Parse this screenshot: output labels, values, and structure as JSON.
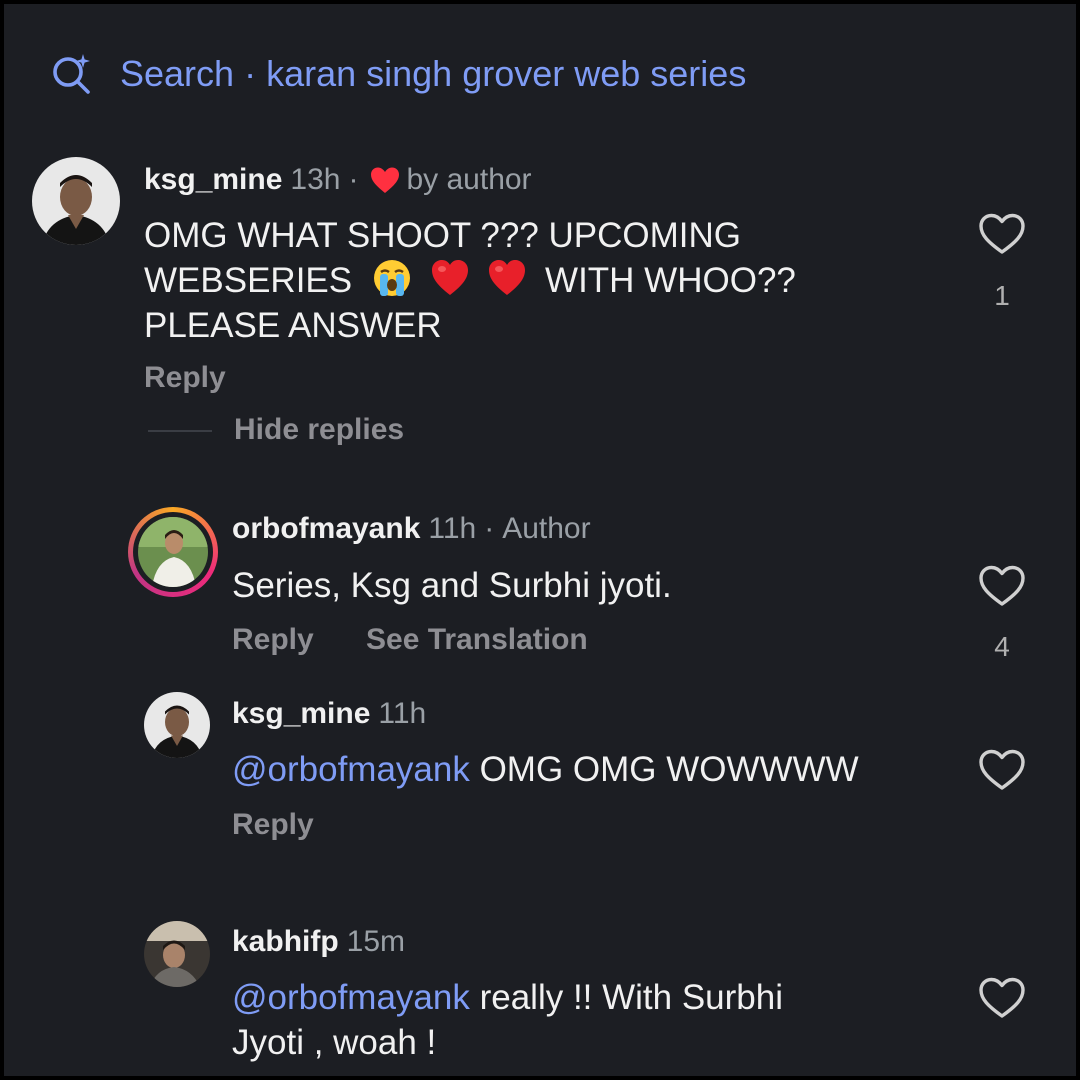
{
  "search": {
    "label": "Search",
    "separator": "·",
    "query": "karan singh grover web series",
    "icon": "search-sparkle-icon"
  },
  "colors": {
    "background": "#1c1e23",
    "link": "#7f9cf5",
    "heart_red": "#ff3040",
    "text": "#f1f1f1",
    "muted": "#9aa0a6"
  },
  "comments": [
    {
      "username": "ksg_mine",
      "time": "13h",
      "separator": "·",
      "liked_by_author": "by author",
      "text_line1": "OMG WHAT SHOOT ??? UPCOMING",
      "text_line2_a": "WEBSERIES",
      "text_line2_b": "WITH WHOO??",
      "text_line3": "PLEASE ANSWER",
      "emojis": [
        "loudly-crying-face",
        "red-heart",
        "red-heart"
      ],
      "reply": "Reply",
      "hide_replies": "Hide replies",
      "likes": "1"
    },
    {
      "username": "orbofmayank",
      "time": "11h",
      "separator": "·",
      "badge": "Author",
      "text": "Series, Ksg and Surbhi jyoti.",
      "reply": "Reply",
      "see_translation": "See Translation",
      "likes": "4"
    },
    {
      "username": "ksg_mine",
      "time": "11h",
      "mention": "@orbofmayank",
      "text": " OMG OMG WOWWWW",
      "reply": "Reply"
    },
    {
      "username": "kabhifp",
      "time": "15m",
      "mention": "@orbofmayank",
      "text_line1": " really !! With Surbhi",
      "text_line2": "Jyoti , woah !"
    }
  ]
}
